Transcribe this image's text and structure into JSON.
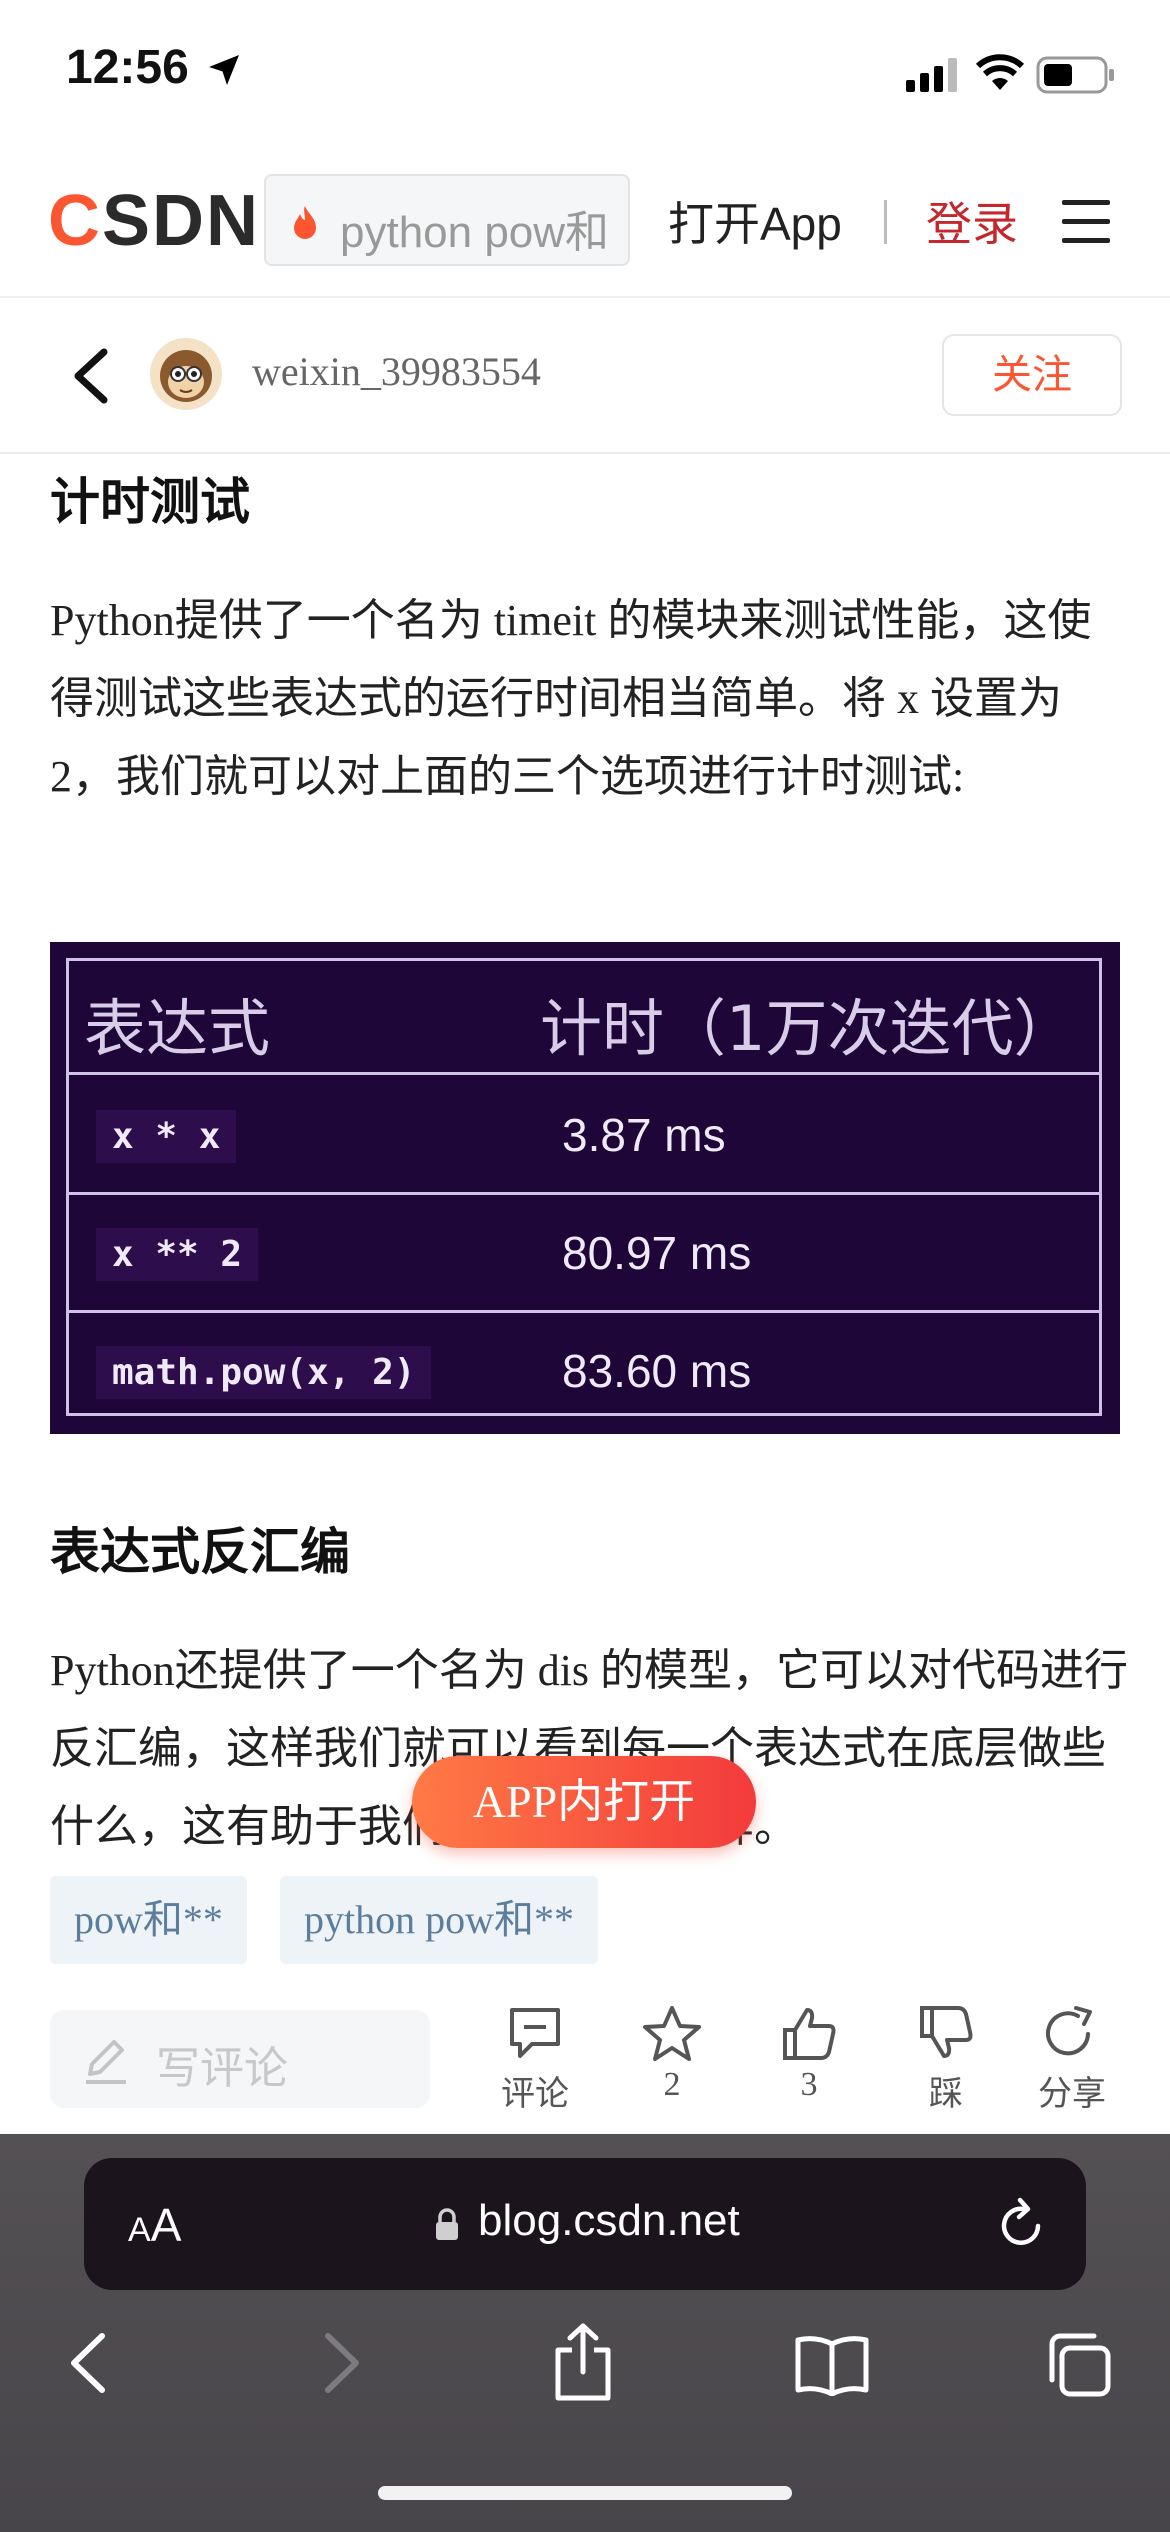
{
  "status_bar": {
    "time": "12:56"
  },
  "header": {
    "logo": {
      "c": "C",
      "rest": "SDN"
    },
    "search_placeholder": "python pow和",
    "open_app": "打开App",
    "login": "登录"
  },
  "author_bar": {
    "name": "weixin_39983554",
    "follow": "关注"
  },
  "article": {
    "section1_title": "计时测试",
    "para1": "Python提供了一个名为 timeit 的模块来测试性能，这使得测试这些表达式的运行时间相当简单。将 x 设置为 2，我们就可以对上面的三个选项进行计时测试:",
    "table": {
      "headers": [
        "表达式",
        "计时（1万次迭代）"
      ],
      "rows": [
        {
          "expr": "x * x",
          "time": "3.87 ms"
        },
        {
          "expr": "x ** 2",
          "time": "80.97 ms"
        },
        {
          "expr": "math.pow(x, 2)",
          "time": "83.60 ms"
        }
      ]
    },
    "section2_title": "表达式反汇编",
    "para2": "Python还提供了一个名为 dis 的模型，它可以对代码进行反汇编，这样我们就可以看到每一个表达式在底层做些什么，这有助于我们理解其性能差异。"
  },
  "tags": [
    "pow和**",
    "python pow和**"
  ],
  "floating_button": "APP内打开",
  "comment_bar": {
    "write_placeholder": "写评论",
    "actions": [
      {
        "icon": "comment-icon",
        "label": "评论"
      },
      {
        "icon": "star-icon",
        "label": "2"
      },
      {
        "icon": "thumbs-up-icon",
        "label": "3"
      },
      {
        "icon": "thumbs-down-icon",
        "label": "踩"
      },
      {
        "icon": "share-icon",
        "label": "分享"
      }
    ]
  },
  "safari": {
    "aa_small": "A",
    "aa_big": "A",
    "url": "blog.csdn.net"
  },
  "colors": {
    "brand": "#fc5531",
    "login": "#c4282c",
    "table_bg": "#1e0638",
    "tag_bg": "#eef3f8",
    "tag_text": "#5d7d9c"
  }
}
